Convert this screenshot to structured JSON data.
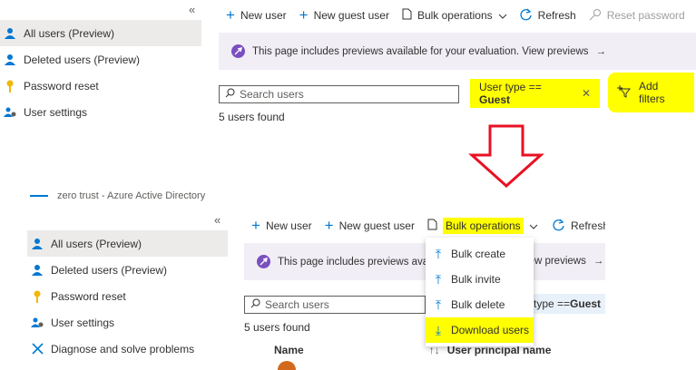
{
  "top": {
    "sidebar": {
      "collapse_icon": "«",
      "items": [
        {
          "label": "All users (Preview)",
          "icon": "user-icon",
          "active": true
        },
        {
          "label": "Deleted users (Preview)",
          "icon": "user-icon"
        },
        {
          "label": "Password reset",
          "icon": "key-icon"
        },
        {
          "label": "User settings",
          "icon": "users-gear-icon"
        }
      ]
    },
    "toolbar": {
      "new_user": "New user",
      "new_guest_user": "New guest user",
      "bulk_operations": "Bulk operations",
      "refresh": "Refresh",
      "reset_password": "Reset password"
    },
    "banner": {
      "text": "This page includes previews available for your evaluation. View previews",
      "arrow": "→"
    },
    "search": {
      "placeholder": "Search users"
    },
    "filter_chip": {
      "prefix": "User type == ",
      "value": "Guest",
      "close": "✕"
    },
    "add_filters": "Add filters",
    "result_count": "5 users found"
  },
  "bottom": {
    "breadcrumb": "zero trust - Azure Active Directory",
    "sidebar": {
      "collapse_icon": "«",
      "items": [
        {
          "label": "All users (Preview)",
          "icon": "user-icon",
          "active": true
        },
        {
          "label": "Deleted users (Preview)",
          "icon": "user-icon"
        },
        {
          "label": "Password reset",
          "icon": "key-icon"
        },
        {
          "label": "User settings",
          "icon": "users-gear-icon"
        },
        {
          "label": "Diagnose and solve problems",
          "icon": "wrench-icon"
        }
      ]
    },
    "toolbar": {
      "new_user": "New user",
      "new_guest_user": "New guest user",
      "bulk_operations": "Bulk operations",
      "refresh": "Refresh"
    },
    "banner": {
      "text_left": "This page includes previews availa",
      "text_right": "iew previews",
      "arrow": "→"
    },
    "search": {
      "placeholder": "Search users"
    },
    "filter_chip_partial": {
      "prefix": "type == ",
      "value": "Guest"
    },
    "result_count": "5 users found",
    "bulk_menu": [
      {
        "label": "Bulk create",
        "icon": "upload-icon"
      },
      {
        "label": "Bulk invite",
        "icon": "upload-icon"
      },
      {
        "label": "Bulk delete",
        "icon": "upload-icon"
      },
      {
        "label": "Download users",
        "icon": "download-icon",
        "highlighted": true
      }
    ],
    "columns": [
      "Name",
      "User principal name"
    ],
    "sort_icon": "↑↓"
  },
  "colors": {
    "accent": "#0078d4",
    "highlight": "#ffff00",
    "arrow": "#e81123",
    "banner": "#f1eef6"
  }
}
